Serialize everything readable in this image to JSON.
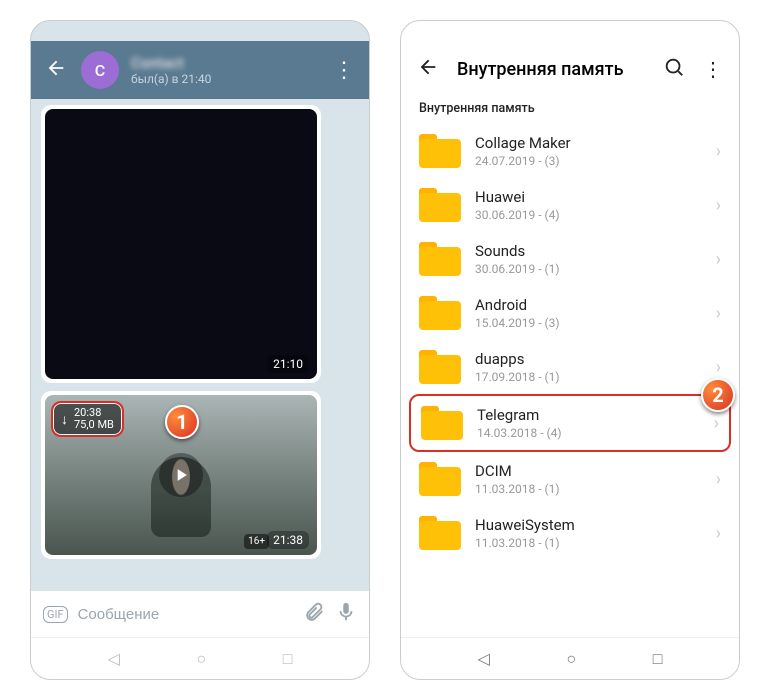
{
  "telegram": {
    "avatar_initial": "C",
    "contact_name": "Contact",
    "last_seen": "был(а) в 21:40",
    "photo_time": "21:10",
    "video": {
      "duration": "20:38",
      "size": "75,0 MB",
      "age_label": "16+",
      "time": "21:38"
    },
    "input_placeholder": "Сообщение",
    "gif_label": "GIF"
  },
  "callouts": {
    "one": "1",
    "two": "2"
  },
  "file_manager": {
    "title": "Внутренняя память",
    "breadcrumb": "Внутренняя память",
    "folders": [
      {
        "name": "Collage Maker",
        "sub": "24.07.2019 - (3)"
      },
      {
        "name": "Huawei",
        "sub": "30.06.2019 - (4)"
      },
      {
        "name": "Sounds",
        "sub": "30.06.2019 - (1)"
      },
      {
        "name": "Android",
        "sub": "15.04.2019 - (3)"
      },
      {
        "name": "duapps",
        "sub": "17.09.2018 - (1)"
      },
      {
        "name": "Telegram",
        "sub": "14.03.2018 - (4)",
        "highlight": true
      },
      {
        "name": "DCIM",
        "sub": "11.03.2018 - (1)"
      },
      {
        "name": "HuaweiSystem",
        "sub": "11.03.2018 - (1)"
      }
    ]
  }
}
